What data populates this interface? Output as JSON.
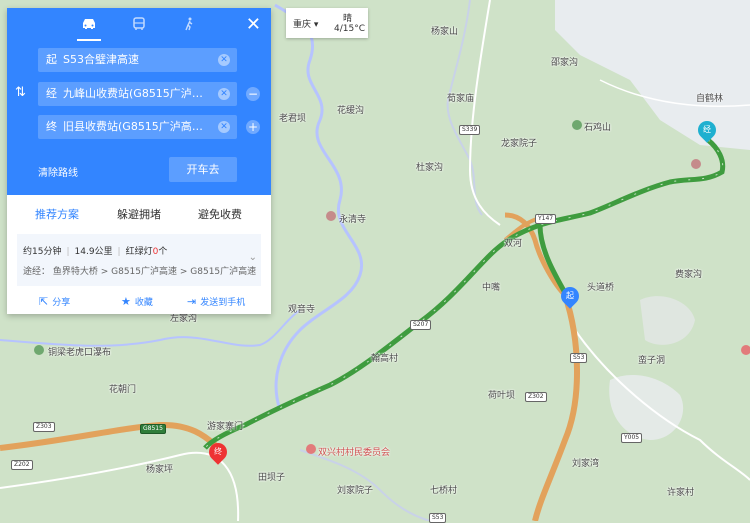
{
  "map": {
    "colors": {
      "land": "#cfe2c8",
      "river": "#b6c3ff",
      "urban": "#e8ecef",
      "road": "#e2a25c",
      "route": "#3f9c3f"
    },
    "labels": [
      "杨家山",
      "邵家沟",
      "荀家庙",
      "自鹤林",
      "花缓沟",
      "老君坝",
      "龙家院子",
      "石鸡山",
      "杜家沟",
      "永清寺",
      "双河",
      "头道桥",
      "中嘴",
      "费家沟",
      "观音寺",
      "左家沟",
      "铜梁老虎口瀑布",
      "花朝门",
      "翰高村",
      "蛮子洞",
      "荷叶坝",
      "游家寨门",
      "杨家坪",
      "田坝子",
      "双兴村村民委员会",
      "刘家湾",
      "刘家院子",
      "七桥村",
      "许家村"
    ],
    "shields": [
      "S339",
      "Y147",
      "S207",
      "S53",
      "G8515",
      "Z302",
      "Z303",
      "Y005",
      "Z202",
      "S53"
    ]
  },
  "panel": {
    "modes": [
      "drive-icon",
      "bus-icon",
      "walk-icon"
    ],
    "start_prefix": "起",
    "start": "S53合璧津高速",
    "via_prefix": "经",
    "via": "九峰山收费站(G8515广泸高速…",
    "end_prefix": "终",
    "end": "旧县收费站(G8515广泸高速出口)",
    "clear_label": "清除路线",
    "drive_label": "开车去",
    "tabs": [
      "推荐方案",
      "躲避拥堵",
      "避免收费"
    ],
    "duration": "约15分钟",
    "distance": "14.9公里",
    "lights_prefix": "红绿灯",
    "lights_count": "0",
    "lights_suffix": "个",
    "via_route": "途经：  鱼界特大桥 > G8515广泸高速 > G8515广泸高速",
    "share": "分享",
    "collect": "收藏",
    "send": "发送到手机"
  },
  "weather": {
    "city": "重庆",
    "cond": "晴",
    "temp": "4/15°C"
  },
  "markers": {
    "start": "起",
    "via": "经",
    "end": "终"
  }
}
